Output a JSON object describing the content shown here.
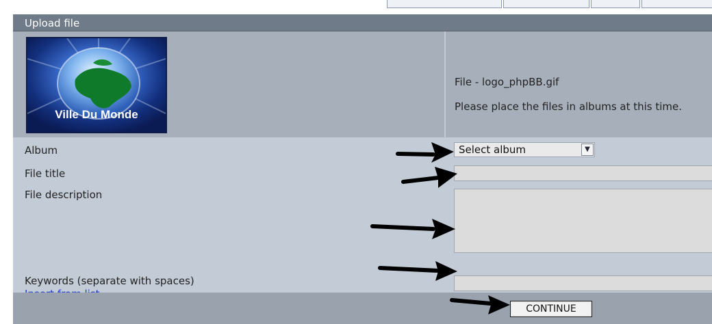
{
  "header": {
    "title": "Upload file"
  },
  "thumbnail": {
    "caption": "Ville Du Monde"
  },
  "info": {
    "file_label": "File - logo_phpBB.gif",
    "notice": "Please place the files in albums at this time."
  },
  "form": {
    "album_label": "Album",
    "album_selected": "Select album",
    "title_label": "File title",
    "title_value": "",
    "description_label": "File description",
    "description_value": "",
    "keywords_label": "Keywords (separate with spaces)",
    "keywords_value": "",
    "insert_link": "Insert from list"
  },
  "footer": {
    "continue_label": "CONTINUE"
  },
  "colors": {
    "header_bg": "#6f7b89",
    "thumb_row_bg": "#a7afba",
    "form_bg": "#c3cbd6",
    "footer_bg": "#99a2ad",
    "link": "#1f3fcf"
  }
}
